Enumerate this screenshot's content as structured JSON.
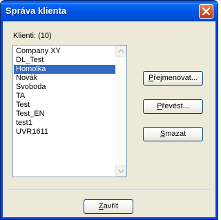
{
  "window": {
    "title": "Správa klienta"
  },
  "clients": {
    "label": "Klienti: (10)",
    "items": [
      {
        "name": "Company XY",
        "selected": false
      },
      {
        "name": "DL_Test",
        "selected": false
      },
      {
        "name": "Homolka",
        "selected": true
      },
      {
        "name": "Novák",
        "selected": false
      },
      {
        "name": "Svoboda",
        "selected": false
      },
      {
        "name": "TA",
        "selected": false
      },
      {
        "name": "Test",
        "selected": false
      },
      {
        "name": "Test_EN",
        "selected": false
      },
      {
        "name": "test1",
        "selected": false
      },
      {
        "name": "UVR1611",
        "selected": false
      }
    ]
  },
  "buttons": {
    "rename_first": "P",
    "rename_rest": "řejmenovat...",
    "convert_first": "P",
    "convert_rest": "řevést...",
    "delete_first": "S",
    "delete_rest": "mazat",
    "close_first": "Z",
    "close_rest": "avřít"
  },
  "colors": {
    "titlebar": "#0054e3",
    "selection": "#316ac5",
    "dialog_bg": "#ece9d8",
    "close_button": "#d9562f"
  },
  "icons": {
    "close": "close-x-icon",
    "scroll_up": "arrow-up-icon",
    "scroll_down": "arrow-down-icon"
  }
}
